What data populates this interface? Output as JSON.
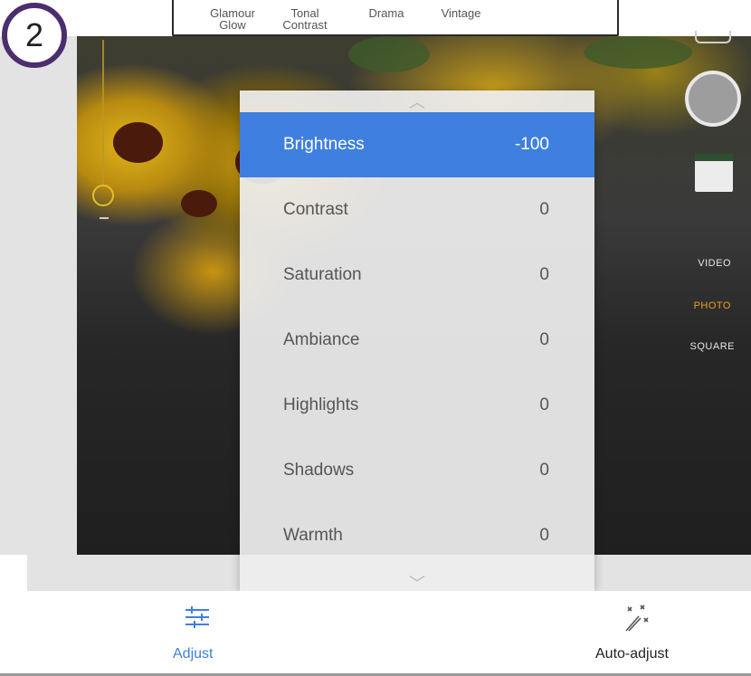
{
  "step_badge": "2",
  "filters": [
    {
      "label": "Glamour\nGlow"
    },
    {
      "label": "Tonal\nContrast"
    },
    {
      "label": "Drama"
    },
    {
      "label": "Vintage"
    }
  ],
  "camera": {
    "modes": [
      {
        "label": "VIDEO",
        "color": "#e6e6e6"
      },
      {
        "label": "PHOTO",
        "color": "#e8a317"
      },
      {
        "label": "SQUARE",
        "color": "#e6e6e6"
      }
    ]
  },
  "adjust_panel": {
    "rows": [
      {
        "label": "Brightness",
        "value": "-100",
        "selected": true
      },
      {
        "label": "Contrast",
        "value": "0"
      },
      {
        "label": "Saturation",
        "value": "0"
      },
      {
        "label": "Ambiance",
        "value": "0"
      },
      {
        "label": "Highlights",
        "value": "0"
      },
      {
        "label": "Shadows",
        "value": "0"
      },
      {
        "label": "Warmth",
        "value": "0"
      }
    ]
  },
  "bottom_bar": {
    "adjust_label": "Adjust",
    "auto_adjust_label": "Auto-adjust",
    "accent_color": "#3f7fdf"
  }
}
